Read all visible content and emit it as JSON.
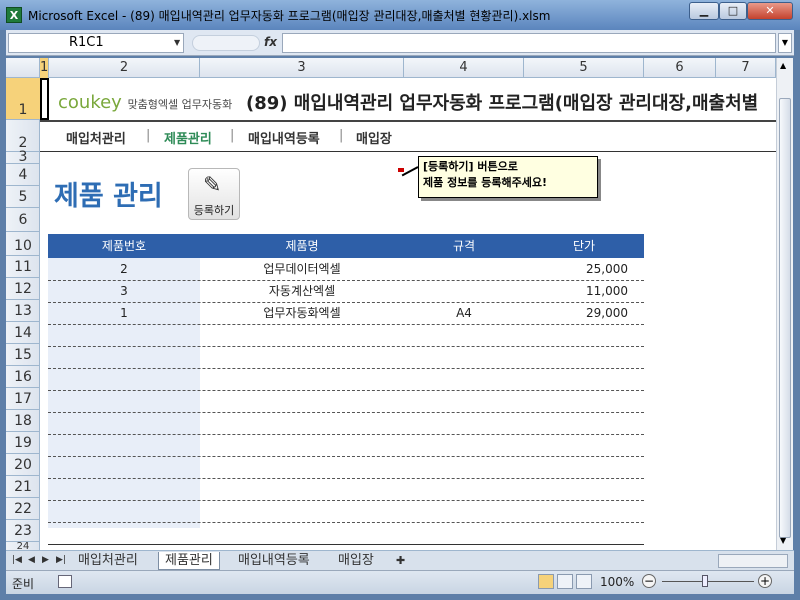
{
  "window": {
    "title": "Microsoft Excel - (89) 매입내역관리 업무자동화 프로그램(매입장 관리대장,매출처별 현황관리).xlsm",
    "app_icon": "X"
  },
  "formula_bar": {
    "name_box": "R1C1",
    "fx_label": "fx",
    "formula": ""
  },
  "columns": [
    "1",
    "2",
    "3",
    "4",
    "5",
    "6",
    "7"
  ],
  "rows": [
    "1",
    "2",
    "3",
    "4",
    "5",
    "6",
    "10",
    "11",
    "12",
    "13",
    "14",
    "15",
    "16",
    "17",
    "18",
    "19",
    "20",
    "21",
    "22",
    "23",
    "24"
  ],
  "sheet": {
    "logo_text": "coukey",
    "logo_sub": "맞춤형엑셀 업무자동화",
    "title": "(89) 매입내역관리 업무자동화 프로그램(매입장 관리대장,매출처별",
    "nav": [
      "매입처관리",
      "제품관리",
      "매입내역등록",
      "매입장"
    ],
    "nav_active_color": "#2e8b57",
    "page_heading": "제품 관리",
    "register_button": "등록하기",
    "register_icon": "pencil-icon",
    "tooltip_line1": "[등록하기] 버튼으로",
    "tooltip_line2": "제품 정보를 등록해주세요!",
    "table": {
      "headers": [
        "제품번호",
        "제품명",
        "규격",
        "단가"
      ],
      "header_color": "#2e5fa8",
      "rows": [
        {
          "no": "2",
          "name": "업무데이터엑셀",
          "spec": "",
          "price": "25,000"
        },
        {
          "no": "3",
          "name": "자동계산엑셀",
          "spec": "",
          "price": "11,000"
        },
        {
          "no": "1",
          "name": "업무자동화엑셀",
          "spec": "A4",
          "price": "29,000"
        }
      ]
    }
  },
  "tabs": [
    "매입처관리",
    "제품관리",
    "매입내역등록",
    "매입장"
  ],
  "active_tab": "제품관리",
  "status": {
    "ready": "준비",
    "zoom": "100%"
  }
}
